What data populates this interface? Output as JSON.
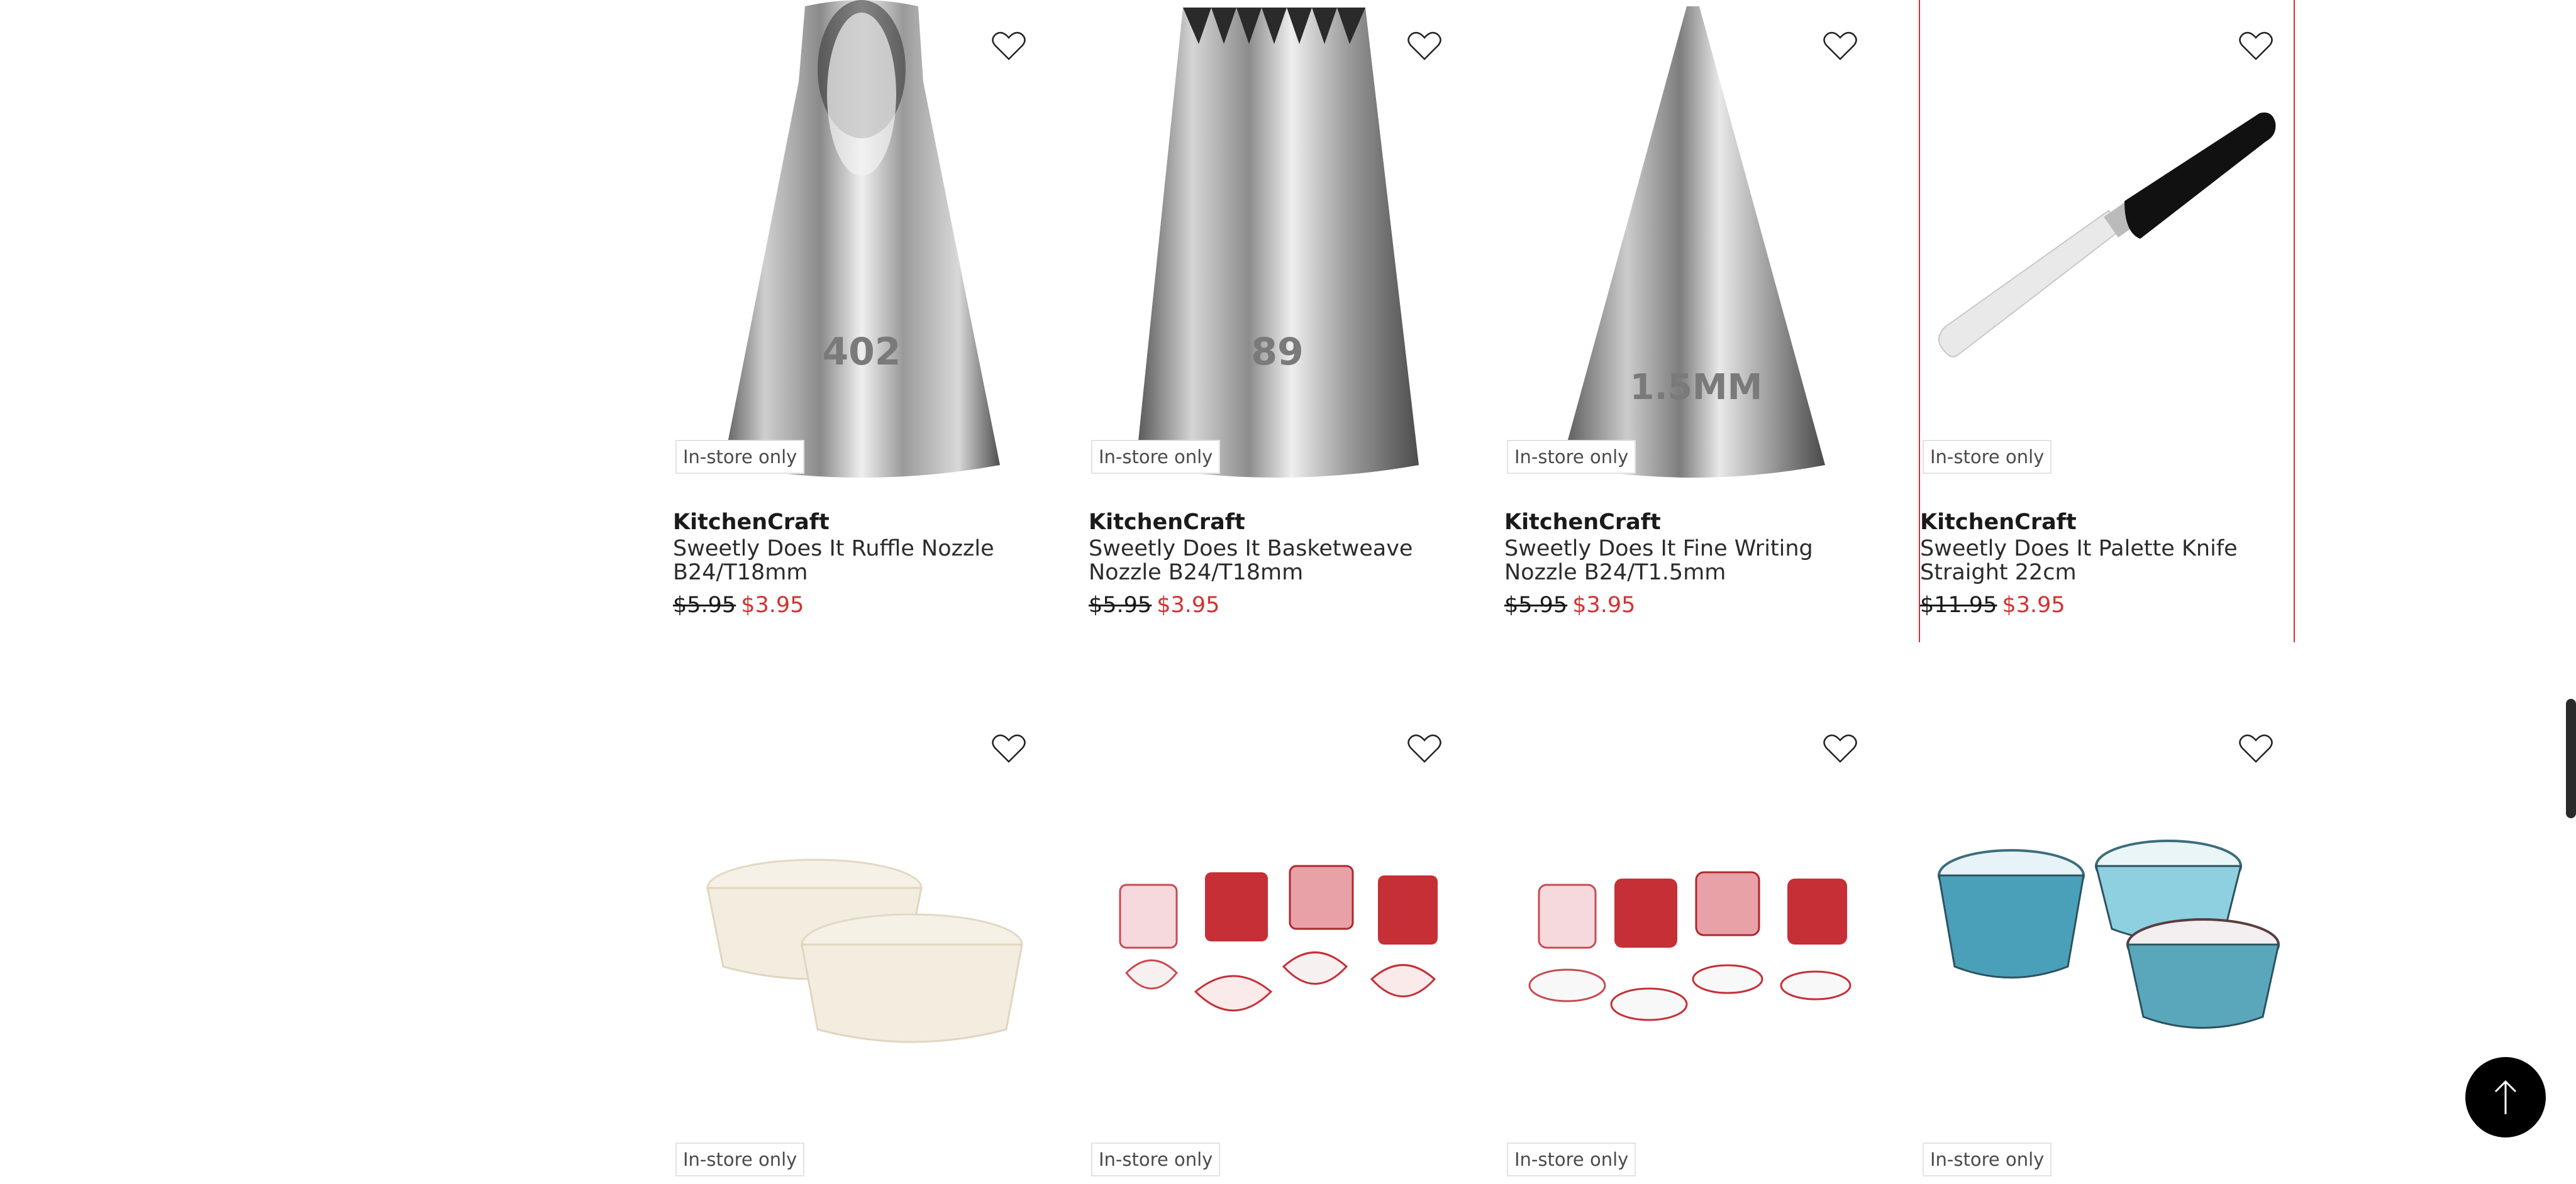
{
  "products": [
    {
      "badge": "In-store only",
      "brand": "KitchenCraft",
      "name": "Sweetly Does It Ruffle Nozzle B24/T18mm",
      "was": "$5.95",
      "now": "$3.95",
      "image": "ruffle-nozzle",
      "engraving": "402"
    },
    {
      "badge": "In-store only",
      "brand": "KitchenCraft",
      "name": "Sweetly Does It Basketweave Nozzle B24/T18mm",
      "was": "$5.95",
      "now": "$3.95",
      "image": "basketweave-nozzle",
      "engraving": "89"
    },
    {
      "badge": "In-store only",
      "brand": "KitchenCraft",
      "name": "Sweetly Does It Fine Writing Nozzle B24/T1.5mm",
      "was": "$5.95",
      "now": "$3.95",
      "image": "writing-nozzle",
      "engraving": "1.5MM"
    },
    {
      "badge": "In-store only",
      "brand": "KitchenCraft",
      "name": "Sweetly Does It Palette Knife Straight 22cm",
      "was": "$11.95",
      "now": "$3.95",
      "image": "palette-knife"
    },
    {
      "badge": "In-store only",
      "image": "white-cupcake-cases"
    },
    {
      "badge": "In-store only",
      "image": "red-heart-cupcake-cases"
    },
    {
      "badge": "In-store only",
      "image": "red-polka-cupcake-cases"
    },
    {
      "badge": "In-store only",
      "image": "blue-zigzag-cupcake-cases"
    }
  ],
  "colors": {
    "sale": "#d3322f",
    "border": "#d3322f"
  },
  "icons": {
    "wishlist": "heart-icon",
    "back_to_top": "arrow-up-icon"
  }
}
